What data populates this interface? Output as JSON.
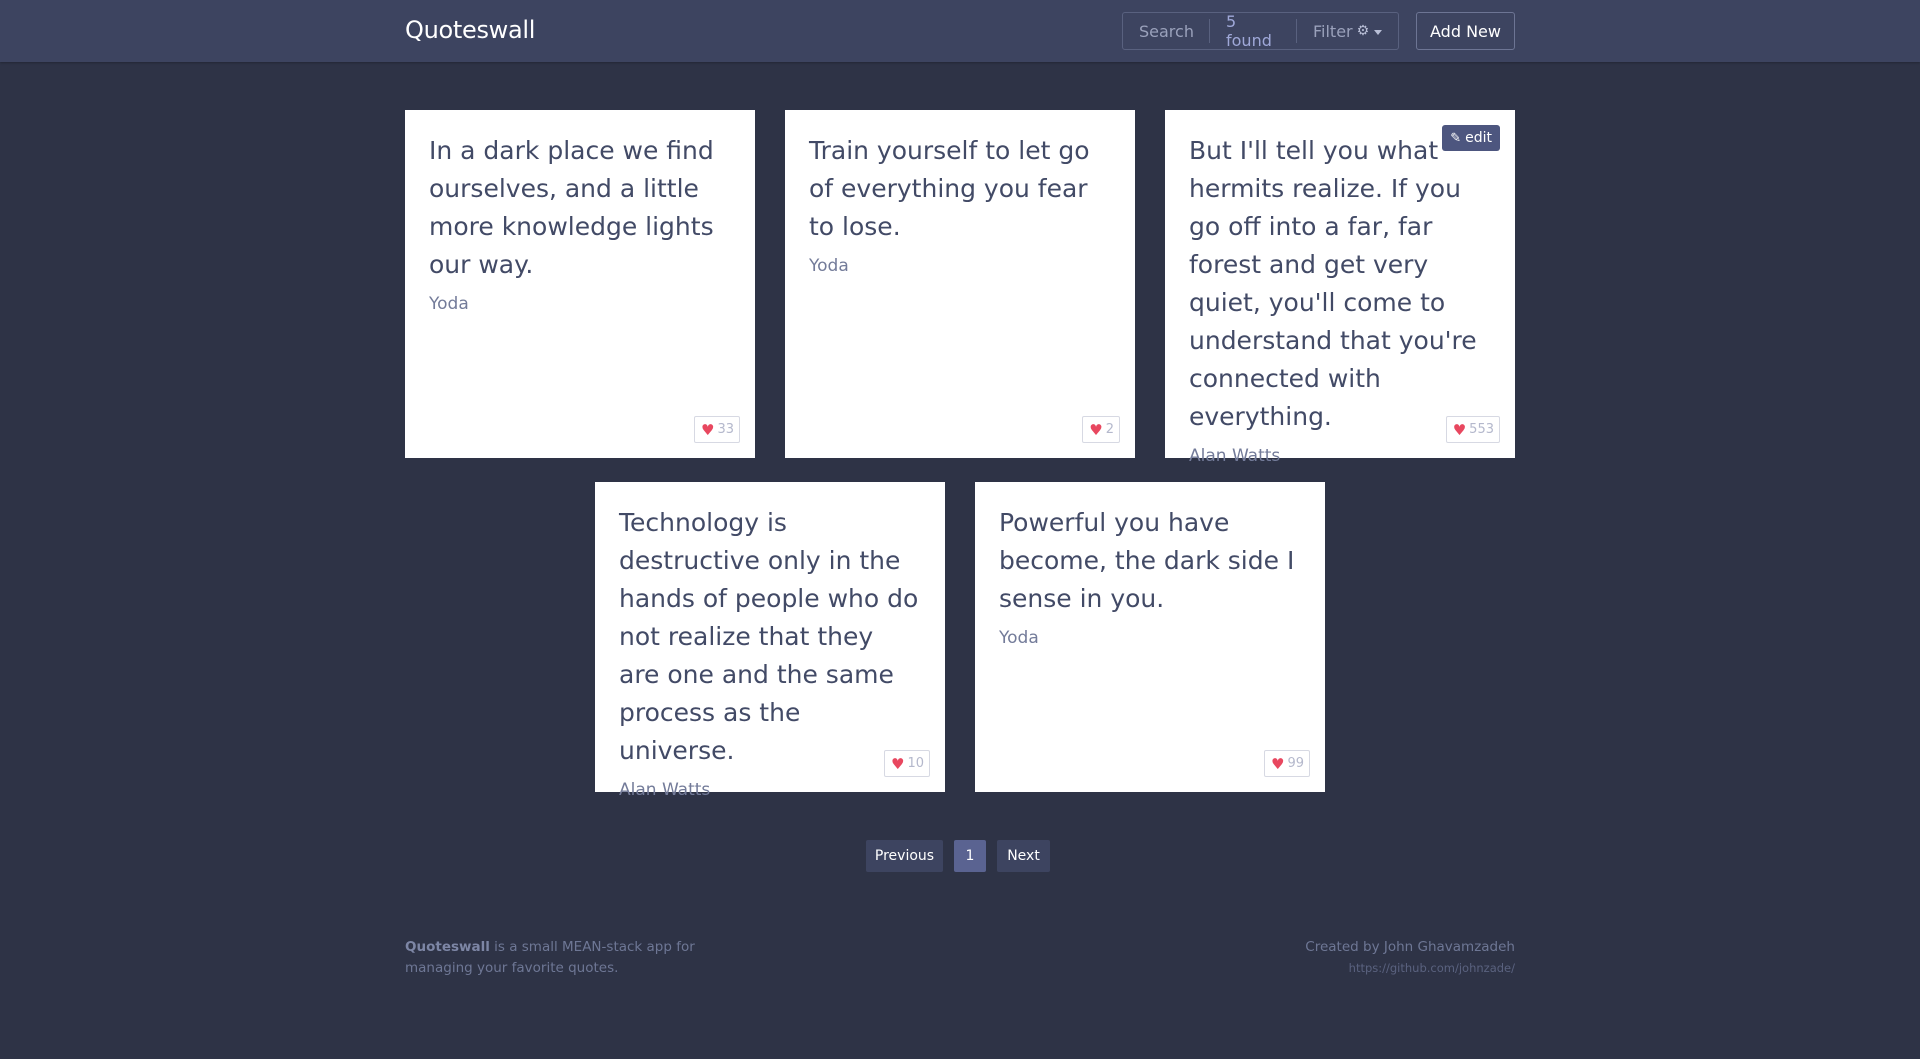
{
  "header": {
    "brand": "Quoteswall",
    "search_label": "Search",
    "found_label": "5 found",
    "filter_label": "Filter",
    "add_new_label": "Add New"
  },
  "quotes": [
    {
      "text": "In a dark place we find ourselves, and a little more knowledge lights our way.",
      "author": "Yoda",
      "likes": "33"
    },
    {
      "text": "Train yourself to let go of everything you fear to lose.",
      "author": "Yoda",
      "likes": "2"
    },
    {
      "text": "But I'll tell you what hermits realize. If you go off into a far, far forest and get very quiet, you'll come to understand that you're connected with everything.",
      "author": "Alan Watts",
      "likes": "553",
      "edit_label": "edit"
    },
    {
      "text": "Technology is destructive only in the hands of people who do not realize that they are one and the same process as the universe.",
      "author": "Alan Watts",
      "likes": "10"
    },
    {
      "text": "Powerful you have become, the dark side I sense in you.",
      "author": "Yoda",
      "likes": "99"
    }
  ],
  "pagination": {
    "previous_label": "Previous",
    "current_page": "1",
    "next_label": "Next"
  },
  "footer": {
    "brand": "Quoteswall",
    "description": " is a small MEAN-stack app for managing your favorite quotes.",
    "credit": "Created by John Ghavamzadeh",
    "url": "https://github.com/johnzade/"
  },
  "colors": {
    "background": "#2e3346",
    "navbar": "#3d4460",
    "heart": "#e8475f",
    "edit_button": "#4d567f"
  },
  "icons": {
    "heart": "heart-icon",
    "gear": "gear-icon",
    "pencil": "pencil-icon"
  }
}
